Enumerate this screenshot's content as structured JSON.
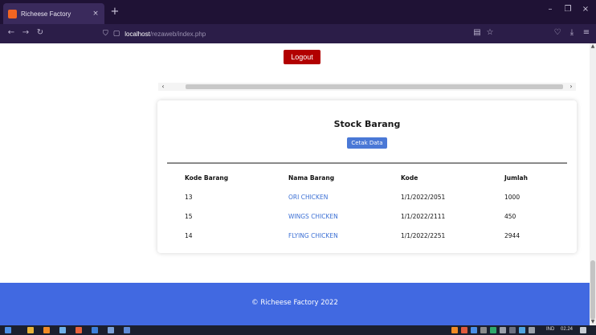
{
  "browser": {
    "tab_title": "Richeese Factory",
    "tab_close": "×",
    "new_tab": "+",
    "url_host": "localhost",
    "url_path": "/rezaweb/index.php",
    "controls": {
      "minimize": "–",
      "maximize": "❐",
      "close": "×"
    },
    "nav": {
      "back": "←",
      "forward": "→",
      "reload": "↻",
      "shield": "⛉",
      "page": "▢"
    },
    "right_icons": {
      "reader": "▤",
      "bookmark": "☆",
      "pocket": "♡",
      "download": "⤓",
      "menu": "≡"
    }
  },
  "page": {
    "logout_label": "Logout",
    "hscroll_left": "‹",
    "hscroll_right": "›",
    "vscroll_up": "▲",
    "vscroll_down": "▼",
    "stock": {
      "title": "Stock Barang",
      "print_label": "Cetak Data",
      "headers": [
        "Kode Barang",
        "Nama Barang",
        "Kode",
        "Jumlah"
      ],
      "rows": [
        [
          "13",
          "ORI CHICKEN",
          "1/1/2022/2051",
          "1000"
        ],
        [
          "15",
          "WINGS CHICKEN",
          "1/1/2022/2111",
          "450"
        ],
        [
          "14",
          "FLYING CHICKEN",
          "1/1/2022/2251",
          "2944"
        ]
      ]
    },
    "footer_text": "© Richeese Factory 2022"
  },
  "taskbar": {
    "lang": "IND",
    "time": "02.24"
  },
  "colors": {
    "tabbar": "#1f1235",
    "navbar": "#2b1d48",
    "logout": "#b20000",
    "print_button": "#4a78d6",
    "link": "#3b6fd4",
    "footer": "#4169e1"
  }
}
